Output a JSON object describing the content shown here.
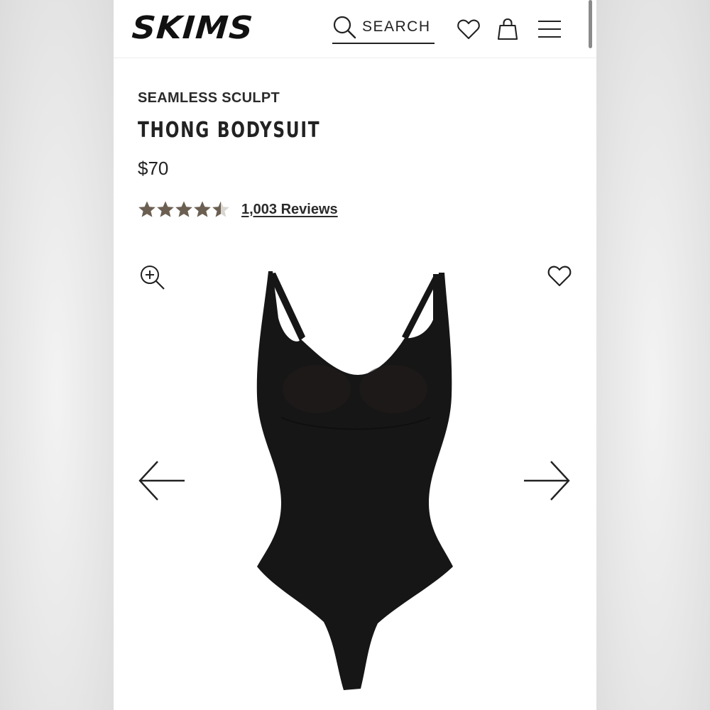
{
  "header": {
    "logo_text": "SKIMS",
    "search_label": "SEARCH",
    "icons": [
      "search-icon",
      "heart-icon",
      "bag-icon",
      "menu-icon"
    ]
  },
  "product": {
    "collection": "SEAMLESS SCULPT",
    "title": "THONG BODYSUIT",
    "price": "$70",
    "rating": 4.5,
    "rating_max": 5,
    "reviews_label": "1,003 Reviews",
    "star_color": "#6b5f52",
    "garment_color": "#161616"
  },
  "gallery": {
    "icons": [
      "zoom-in-icon",
      "favorite-heart-icon",
      "arrow-left-icon",
      "arrow-right-icon"
    ]
  }
}
